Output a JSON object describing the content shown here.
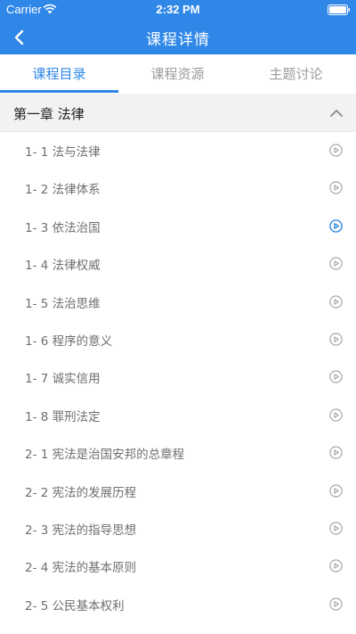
{
  "status_bar": {
    "carrier": "Carrier",
    "time": "2:32 PM"
  },
  "nav": {
    "title": "课程详情",
    "back_icon": "chevron-left-icon"
  },
  "tabs": [
    {
      "label": "课程目录",
      "active": true
    },
    {
      "label": "课程资源",
      "active": false
    },
    {
      "label": "主题讨论",
      "active": false
    }
  ],
  "chapter": {
    "title": "第一章 法律",
    "expanded": true
  },
  "lessons": [
    {
      "label": "1- 1 法与法律",
      "playing": false
    },
    {
      "label": "1- 2 法律体系",
      "playing": false
    },
    {
      "label": "1- 3 依法治国",
      "playing": true
    },
    {
      "label": "1- 4 法律权威",
      "playing": false
    },
    {
      "label": "1- 5 法治思维",
      "playing": false
    },
    {
      "label": "1- 6 程序的意义",
      "playing": false
    },
    {
      "label": "1- 7 诚实信用",
      "playing": false
    },
    {
      "label": "1- 8 罪刑法定",
      "playing": false
    },
    {
      "label": "2- 1 宪法是治国安邦的总章程",
      "playing": false
    },
    {
      "label": "2- 2 宪法的发展历程",
      "playing": false
    },
    {
      "label": "2- 3 宪法的指导思想",
      "playing": false
    },
    {
      "label": "2- 4 宪法的基本原则",
      "playing": false
    },
    {
      "label": "2- 5 公民基本权利",
      "playing": false
    }
  ],
  "colors": {
    "accent": "#2f87e8",
    "inactive_icon": "#a0a0a0"
  }
}
